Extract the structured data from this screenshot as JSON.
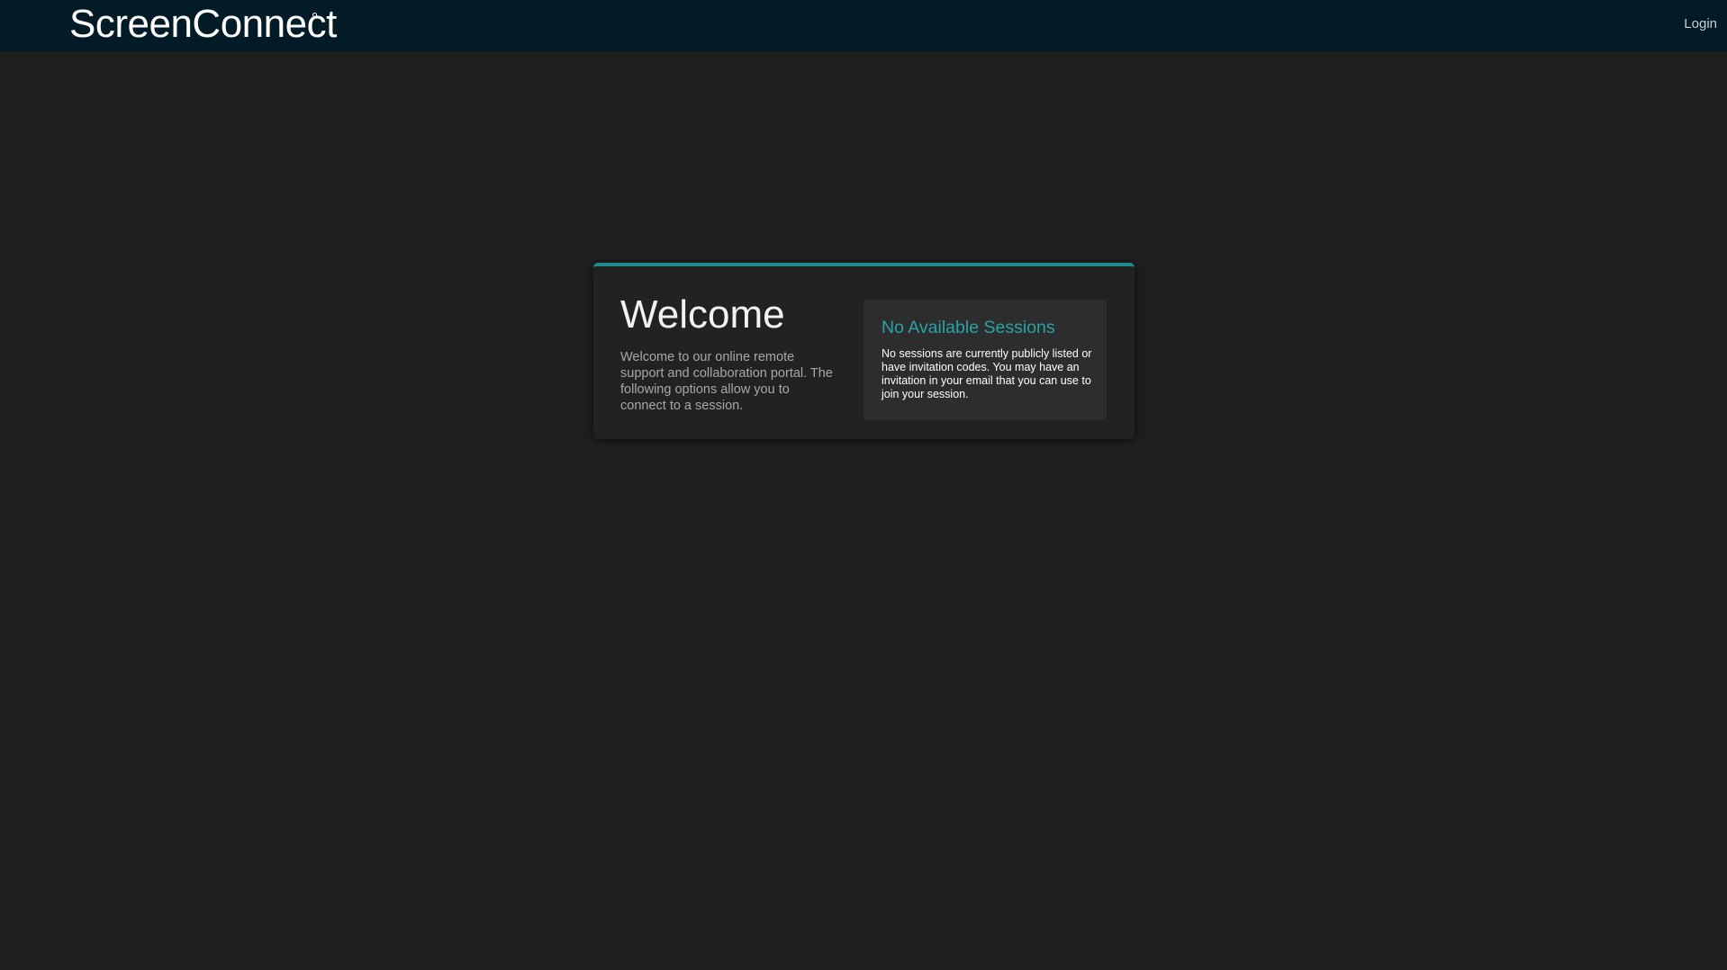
{
  "header": {
    "logo_text": "ScreenConnect",
    "login_label": "Login"
  },
  "welcome": {
    "title": "Welcome",
    "text": "Welcome to our online remote support and collaboration portal. The following options allow you to connect to a session."
  },
  "sessions": {
    "title": "No Available Sessions",
    "text": "No sessions are currently publicly listed or have invitation codes. You may have an invitation in your email that you can use to join your session."
  },
  "colors": {
    "header_bg": "#021b26",
    "page_bg": "#1f1f1f",
    "accent": "#1f8a8f",
    "sessions_title": "#2aa3a8"
  }
}
